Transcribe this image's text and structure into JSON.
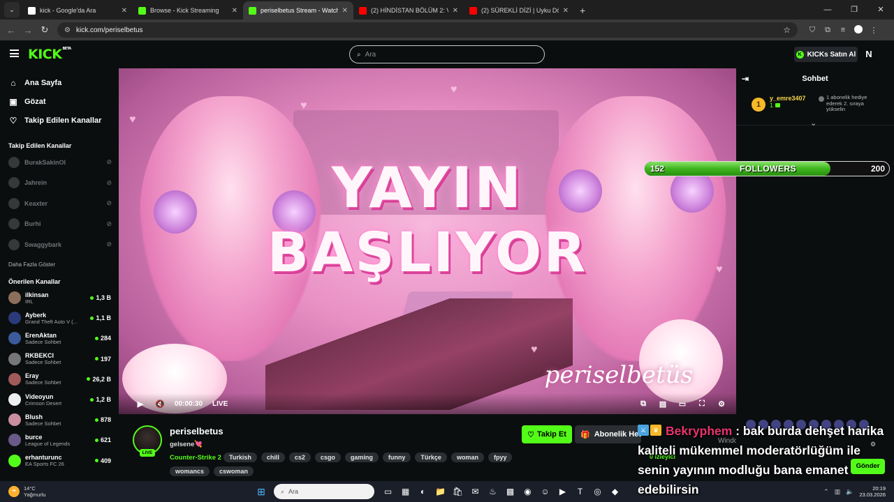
{
  "browser": {
    "tabs": [
      {
        "label": "kick - Google'da Ara",
        "icon": "google-icon",
        "color": "#ffffff",
        "active": false
      },
      {
        "label": "Browse - Kick Streaming",
        "icon": "kick-icon",
        "color": "#53fc18",
        "active": false
      },
      {
        "label": "periselbetus Stream - Watch Li",
        "icon": "kick-icon",
        "color": "#53fc18",
        "active": true
      },
      {
        "label": "(2) HİNDİSTAN BÖLÜM 2: VARA",
        "icon": "youtube-icon",
        "color": "#ff0000",
        "active": false
      },
      {
        "label": "(2) SÜREKLİ DİZİ | Uyku Döngü",
        "icon": "youtube-icon",
        "color": "#ff0000",
        "active": false
      }
    ],
    "url": "kick.com/periselbetus"
  },
  "header": {
    "logo": "KICK",
    "logo_badge": "BETA",
    "search_placeholder": "Ara",
    "kicks_button": "KICKs Satın Al",
    "notif_letter": "N"
  },
  "sidebar": {
    "nav": [
      {
        "label": "Ana Sayfa",
        "icon": "home-icon",
        "glyph": "⌂"
      },
      {
        "label": "Gözat",
        "icon": "browse-icon",
        "glyph": "▣"
      },
      {
        "label": "Takip Edilen Kanallar",
        "icon": "heart-icon",
        "glyph": "♡"
      }
    ],
    "followed_heading": "Takip Edilen Kanallar",
    "followed": [
      {
        "name": "BurakSakinOl"
      },
      {
        "name": "Jahrein"
      },
      {
        "name": "Keaxter"
      },
      {
        "name": "Burhi"
      },
      {
        "name": "Swaggybark"
      }
    ],
    "show_more": "Daha Fazla Göster",
    "recommended_heading": "Önerilen Kanallar",
    "recommended": [
      {
        "name": "ilkinsan",
        "category": "IRL",
        "viewers": "1,3 B",
        "color": "#8c6f5a"
      },
      {
        "name": "Ayberk",
        "category": "Grand Theft Auto V (...",
        "viewers": "1,1 B",
        "color": "#2a3a7a"
      },
      {
        "name": "ErenAktan",
        "category": "Sadece Sohbet",
        "viewers": "284",
        "color": "#3a5a9a"
      },
      {
        "name": "RKBEKCI",
        "category": "Sadece Sohbet",
        "viewers": "197",
        "color": "#777777"
      },
      {
        "name": "Eray",
        "category": "Sadece Sohbet",
        "viewers": "26,2 B",
        "color": "#a05a5a"
      },
      {
        "name": "Videoyun",
        "category": "Crimson Desert",
        "viewers": "1,2 B",
        "color": "#eeeeee"
      },
      {
        "name": "Blush",
        "category": "Sadece Sohbet",
        "viewers": "878",
        "color": "#c98ea0"
      },
      {
        "name": "burce",
        "category": "League of Legends",
        "viewers": "621",
        "color": "#6a5a8a"
      },
      {
        "name": "erhanturunc",
        "category": "EA Sports FC 26",
        "viewers": "409",
        "color": "#53fc18"
      }
    ]
  },
  "video": {
    "title_line1": "YAYIN",
    "title_line2": "BAŞLIYOR",
    "signature": "periselbetüs",
    "time": "00:00:30",
    "live_label": "LIVE"
  },
  "channel": {
    "name": "periselbetus",
    "stream_title": "gelsene",
    "stream_title_emoji": "💘",
    "live_badge": "LIVE",
    "category": "Counter-Strike 2",
    "tags": [
      "Turkish",
      "chill",
      "cs2",
      "csgo",
      "gaming",
      "funny",
      "Türkçe",
      "woman",
      "fpyy"
    ],
    "tags_row2": [
      "womancs",
      "cswoman"
    ],
    "follow_button": "Takip Et",
    "gift_button": "Abonelik Hediye Et",
    "viewers": "0 izleyici",
    "windows_watermark": "Windows'u Etkinleştir"
  },
  "chat": {
    "title": "Sohbet",
    "pinned": {
      "user": "y_emre3407",
      "badge_rank": "1",
      "sub_count": "1",
      "message": "1 abonelik hediye ederek 2. sıraya yükselin"
    },
    "send_button": "Gönder"
  },
  "followers_goal": {
    "current": 152,
    "label": "FOLLOWERS",
    "goal": 200,
    "progress": 0.76
  },
  "overlay_message": {
    "user": "Bekryphem",
    "text": ": bak burda dehşet harika kaliteli mükemmel moderatörlüğüm ile senin yayının modluğu bana emanet edebilirsin"
  },
  "taskbar": {
    "temperature": "14°C",
    "weather": "Yağmurlu",
    "search_placeholder": "Ara",
    "time": "20:19",
    "date": "23.03.2026",
    "apps": [
      "task-view-icon",
      "widgets-icon",
      "edge-icon",
      "file-explorer-icon",
      "store-icon",
      "mail-icon",
      "steam-icon",
      "minecraft-icon",
      "chrome-icon",
      "discord-icon",
      "media-player-icon",
      "teams-icon",
      "obs-icon",
      "extra-app-icon"
    ]
  }
}
